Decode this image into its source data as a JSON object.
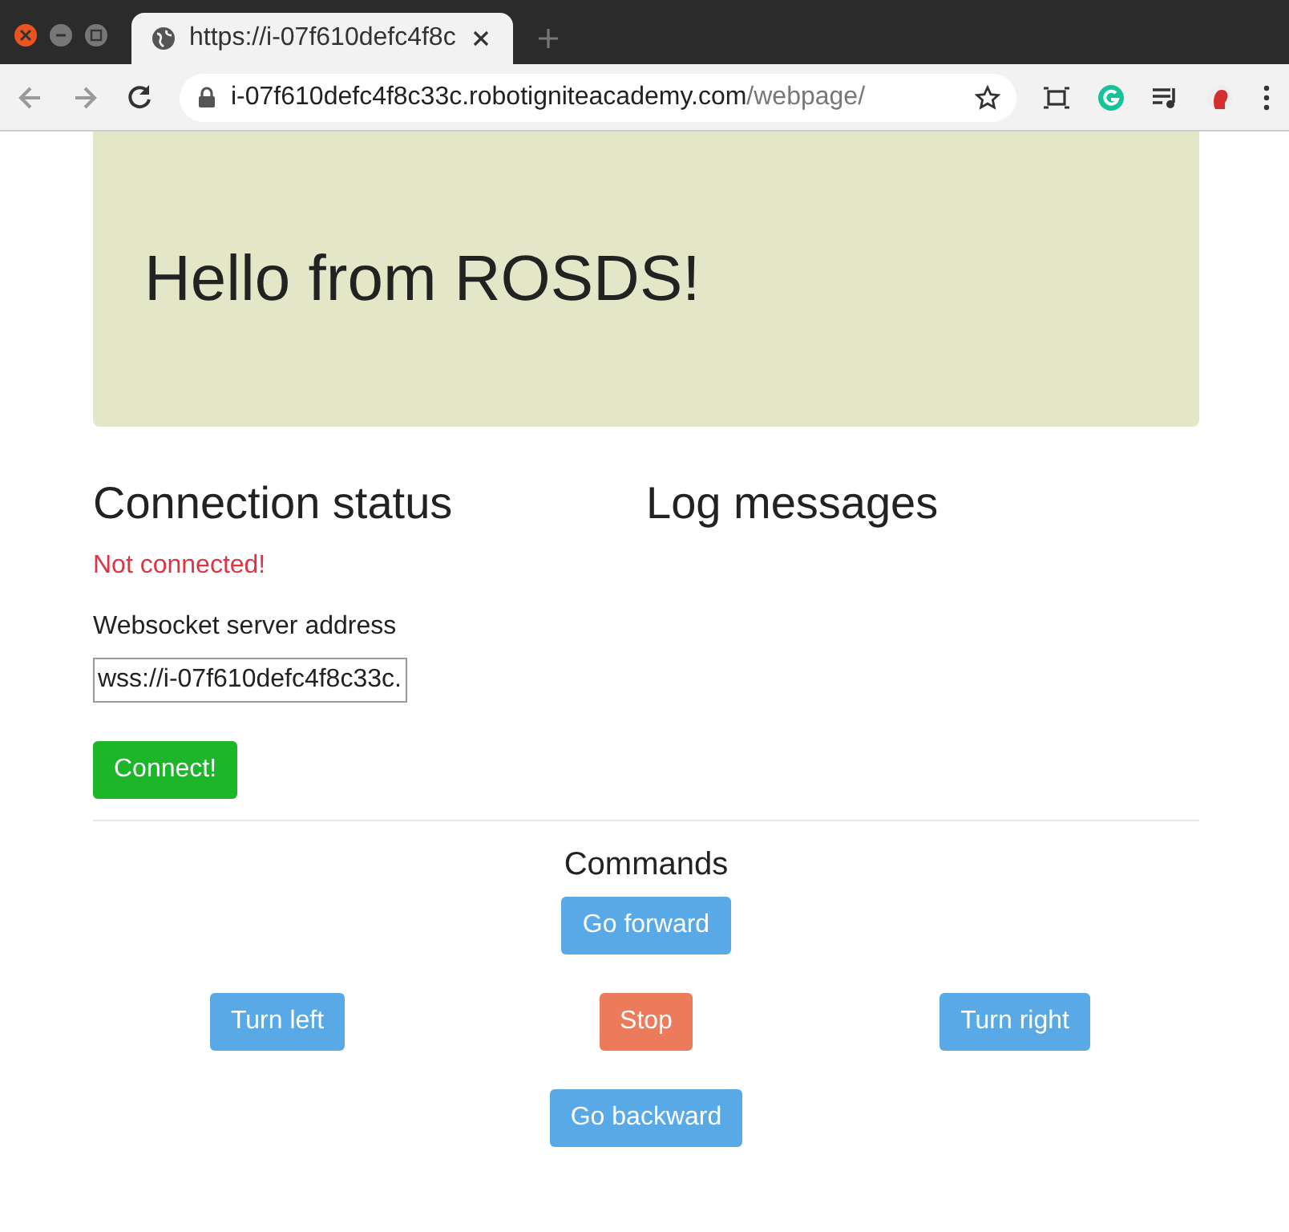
{
  "browser": {
    "tab": {
      "title": "https://i-07f610defc4f8c",
      "selected": true
    },
    "address": {
      "host": "i-07f610defc4f8c33c.robotigniteacademy.com",
      "path": "/webpage/"
    }
  },
  "jumbotron": {
    "title": "Hello from ROSDS!"
  },
  "connection": {
    "heading": "Connection status",
    "status": "Not connected!",
    "connected": false,
    "address_label": "Websocket server address",
    "address_value": "wss://i-07f610defc4f8c33c.",
    "button": "Connect!"
  },
  "log": {
    "heading": "Log messages"
  },
  "commands": {
    "heading": "Commands",
    "rows": [
      {
        "buttons": [
          {
            "label": "Go forward",
            "kind": "move"
          }
        ]
      },
      {
        "buttons": [
          {
            "label": "Turn left",
            "kind": "move"
          },
          {
            "label": "Stop",
            "kind": "stop"
          },
          {
            "label": "Turn right",
            "kind": "move"
          }
        ]
      },
      {
        "buttons": [
          {
            "label": "Go backward",
            "kind": "move"
          }
        ]
      }
    ]
  }
}
